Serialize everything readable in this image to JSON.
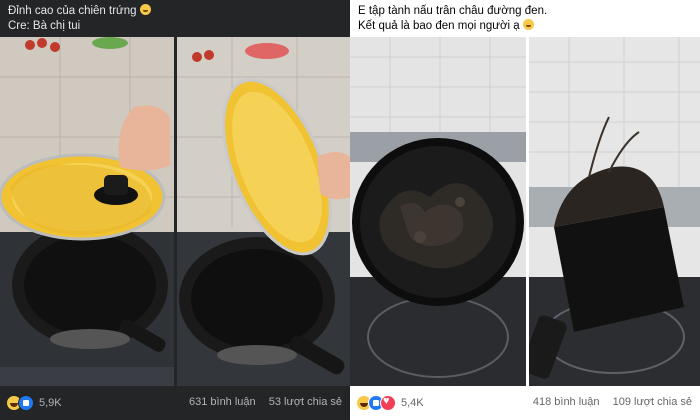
{
  "left_post": {
    "caption_line1": "Đỉnh cao của chiên trứng",
    "caption_line2": "Cre: Bà chị tui",
    "reaction_count": "5,9K",
    "comments": "631 bình luận",
    "shares": "53 lượt chia sẻ",
    "photos": [
      {
        "name": "egg-pan-lid-photo",
        "desc_icon": "omelette-lid"
      },
      {
        "name": "egg-lid-tilted-photo",
        "desc_icon": "omelette-lid"
      }
    ]
  },
  "right_post": {
    "caption_line1": "E tập tành nấu trân châu đường đen.",
    "caption_line2": "Kết quả là bao đen mọi người ạ",
    "reaction_count": "5,4K",
    "comments": "418 bình luận",
    "shares": "109 lượt chia sẻ",
    "photos": [
      {
        "name": "burnt-pot-top-photo",
        "desc_icon": "burnt-pot"
      },
      {
        "name": "burnt-pot-side-photo",
        "desc_icon": "burnt-pot"
      }
    ]
  },
  "colors": {
    "dark_bg": "#242526",
    "egg_yellow": "#f1c232",
    "pan_black": "#161616",
    "like_blue": "#2078f4",
    "haha_yellow": "#f7c948"
  }
}
